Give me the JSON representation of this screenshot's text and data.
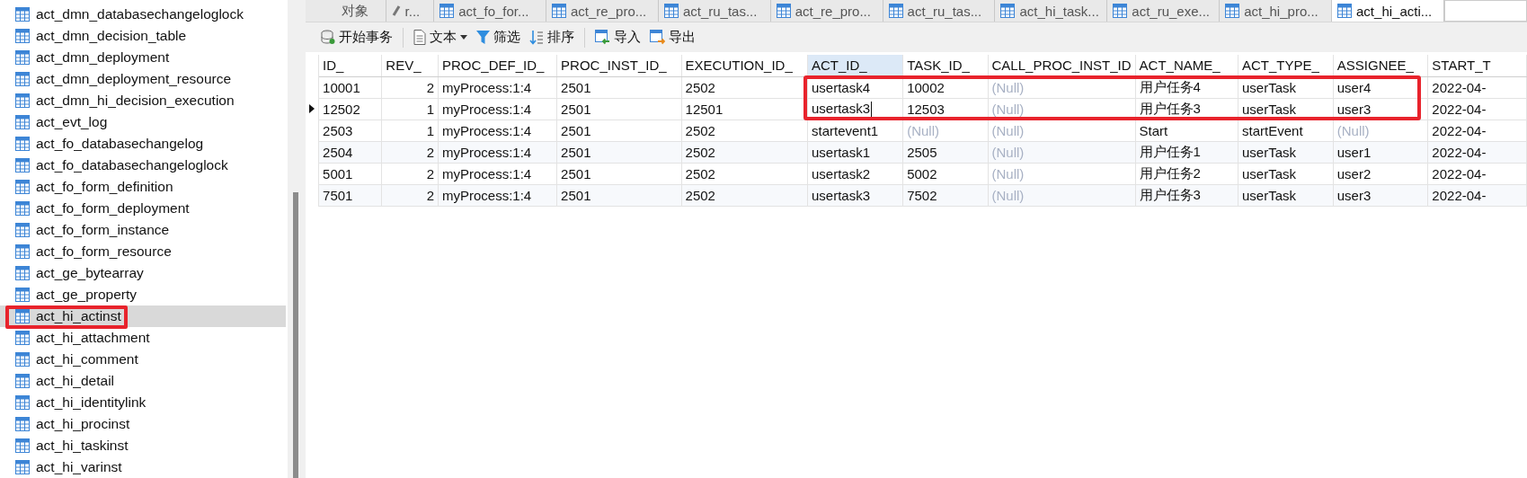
{
  "sidebar": {
    "items": [
      {
        "label": "act_dmn_databasechangeloglock",
        "selected": false,
        "marked": false
      },
      {
        "label": "act_dmn_decision_table",
        "selected": false,
        "marked": false
      },
      {
        "label": "act_dmn_deployment",
        "selected": false,
        "marked": false
      },
      {
        "label": "act_dmn_deployment_resource",
        "selected": false,
        "marked": false
      },
      {
        "label": "act_dmn_hi_decision_execution",
        "selected": false,
        "marked": false
      },
      {
        "label": "act_evt_log",
        "selected": false,
        "marked": false
      },
      {
        "label": "act_fo_databasechangelog",
        "selected": false,
        "marked": false
      },
      {
        "label": "act_fo_databasechangeloglock",
        "selected": false,
        "marked": false
      },
      {
        "label": "act_fo_form_definition",
        "selected": false,
        "marked": false
      },
      {
        "label": "act_fo_form_deployment",
        "selected": false,
        "marked": false
      },
      {
        "label": "act_fo_form_instance",
        "selected": false,
        "marked": false
      },
      {
        "label": "act_fo_form_resource",
        "selected": false,
        "marked": false
      },
      {
        "label": "act_ge_bytearray",
        "selected": false,
        "marked": false
      },
      {
        "label": "act_ge_property",
        "selected": false,
        "marked": false
      },
      {
        "label": "act_hi_actinst",
        "selected": true,
        "marked": true
      },
      {
        "label": "act_hi_attachment",
        "selected": false,
        "marked": false
      },
      {
        "label": "act_hi_comment",
        "selected": false,
        "marked": false
      },
      {
        "label": "act_hi_detail",
        "selected": false,
        "marked": false
      },
      {
        "label": "act_hi_identitylink",
        "selected": false,
        "marked": false
      },
      {
        "label": "act_hi_procinst",
        "selected": false,
        "marked": false
      },
      {
        "label": "act_hi_taskinst",
        "selected": false,
        "marked": false
      },
      {
        "label": "act_hi_varinst",
        "selected": false,
        "marked": false
      }
    ]
  },
  "tabs": [
    {
      "label": "对象",
      "kind": "objects",
      "selected": false
    },
    {
      "label": "r...",
      "kind": "query",
      "selected": false
    },
    {
      "label": "act_fo_for...",
      "kind": "table",
      "selected": false
    },
    {
      "label": "act_re_pro...",
      "kind": "table",
      "selected": false
    },
    {
      "label": "act_ru_tas...",
      "kind": "table",
      "selected": false
    },
    {
      "label": "act_re_pro...",
      "kind": "table",
      "selected": false
    },
    {
      "label": "act_ru_tas...",
      "kind": "table",
      "selected": false
    },
    {
      "label": "act_hi_task...",
      "kind": "table",
      "selected": false
    },
    {
      "label": "act_ru_exe...",
      "kind": "table",
      "selected": false
    },
    {
      "label": "act_hi_pro...",
      "kind": "table",
      "selected": false
    },
    {
      "label": "act_hi_acti...",
      "kind": "table",
      "selected": true
    }
  ],
  "toolbar": [
    {
      "label": "开始事务",
      "kind": "transaction",
      "dropdown": false
    },
    {
      "label": "文本",
      "kind": "text",
      "dropdown": true
    },
    {
      "label": "筛选",
      "kind": "filter",
      "dropdown": false
    },
    {
      "label": "排序",
      "kind": "sort",
      "dropdown": false
    },
    {
      "label": "导入",
      "kind": "import",
      "dropdown": false
    },
    {
      "label": "导出",
      "kind": "export",
      "dropdown": false
    }
  ],
  "table": {
    "columns": [
      {
        "name": "ID_",
        "kind": "text",
        "selected": false
      },
      {
        "name": "REV_",
        "kind": "number",
        "selected": false
      },
      {
        "name": "PROC_DEF_ID_",
        "kind": "text",
        "selected": false
      },
      {
        "name": "PROC_INST_ID_",
        "kind": "text",
        "selected": false
      },
      {
        "name": "EXECUTION_ID_",
        "kind": "text",
        "selected": false
      },
      {
        "name": "ACT_ID_",
        "kind": "text",
        "selected": true
      },
      {
        "name": "TASK_ID_",
        "kind": "text",
        "selected": false
      },
      {
        "name": "CALL_PROC_INST_ID",
        "kind": "text",
        "selected": false
      },
      {
        "name": "ACT_NAME_",
        "kind": "text",
        "selected": false
      },
      {
        "name": "ACT_TYPE_",
        "kind": "text",
        "selected": false
      },
      {
        "name": "ASSIGNEE_",
        "kind": "text",
        "selected": false
      },
      {
        "name": "START_T",
        "kind": "text",
        "selected": false
      }
    ],
    "rows": [
      {
        "current": false,
        "marked": true,
        "cells": [
          "10001",
          "2",
          "myProcess:1:4",
          "2501",
          "2502",
          "usertask4",
          "10002",
          {
            "text": "(Null)",
            "null": true
          },
          "用户任务4",
          "userTask",
          "user4",
          "2022-04-"
        ]
      },
      {
        "current": true,
        "marked": true,
        "cells": [
          "12502",
          "1",
          "myProcess:1:4",
          "2501",
          "12501",
          "usertask3",
          "12503",
          {
            "text": "(Null)",
            "null": true
          },
          "用户任务3",
          "userTask",
          "user3",
          "2022-04-"
        ]
      },
      {
        "current": false,
        "marked": false,
        "cells": [
          "2503",
          "1",
          "myProcess:1:4",
          "2501",
          "2502",
          "startevent1",
          {
            "text": "(Null)",
            "null": true
          },
          {
            "text": "(Null)",
            "null": true
          },
          "Start",
          "startEvent",
          {
            "text": "(Null)",
            "null": true
          },
          "2022-04-"
        ]
      },
      {
        "current": false,
        "marked": false,
        "cells": [
          "2504",
          "2",
          "myProcess:1:4",
          "2501",
          "2502",
          "usertask1",
          "2505",
          {
            "text": "(Null)",
            "null": true
          },
          "用户任务1",
          "userTask",
          "user1",
          "2022-04-"
        ]
      },
      {
        "current": false,
        "marked": false,
        "cells": [
          "5001",
          "2",
          "myProcess:1:4",
          "2501",
          "2502",
          "usertask2",
          "5002",
          {
            "text": "(Null)",
            "null": true
          },
          "用户任务2",
          "userTask",
          "user2",
          "2022-04-"
        ]
      },
      {
        "current": false,
        "marked": false,
        "cells": [
          "7501",
          "2",
          "myProcess:1:4",
          "2501",
          "2502",
          "usertask3",
          "7502",
          {
            "text": "(Null)",
            "null": true
          },
          "用户任务3",
          "userTask",
          "user3",
          "2022-04-"
        ]
      }
    ]
  }
}
